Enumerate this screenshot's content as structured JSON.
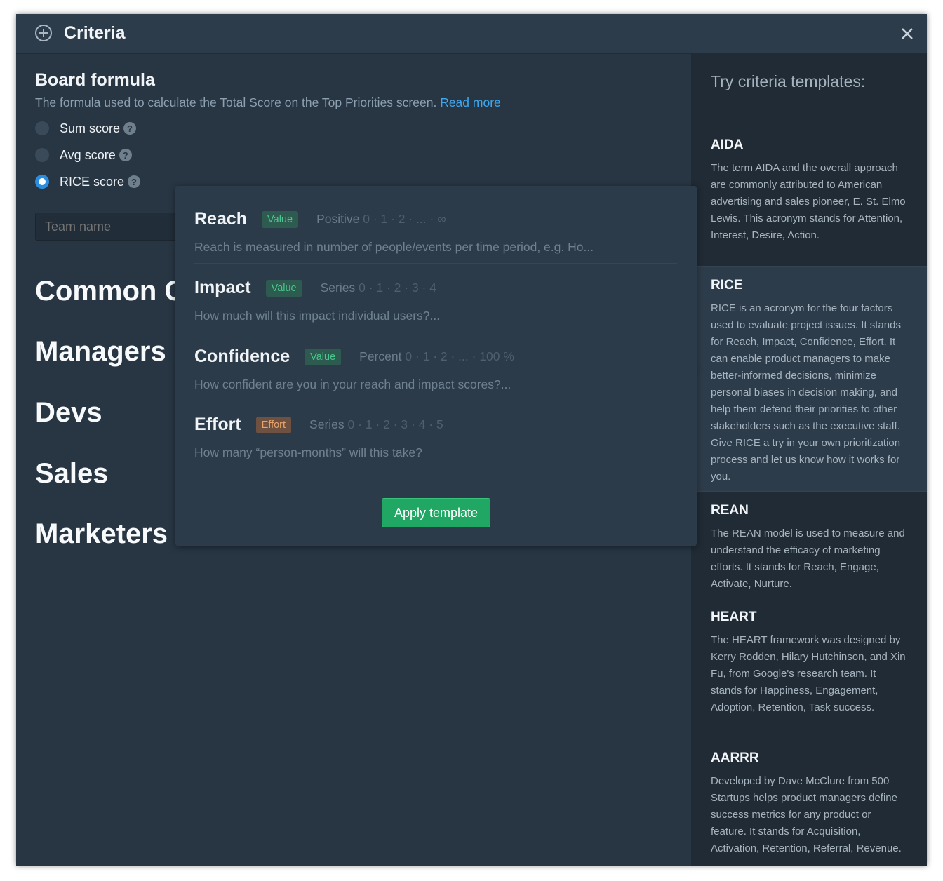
{
  "header": {
    "title": "Criteria"
  },
  "board_formula": {
    "title": "Board formula",
    "description": "The formula used to calculate the Total Score on the Top Priorities screen.",
    "read_more": "Read more",
    "options": [
      {
        "label": "Sum score",
        "checked": false
      },
      {
        "label": "Avg score",
        "checked": false
      },
      {
        "label": "RICE score",
        "checked": true
      }
    ],
    "help_glyph": "?"
  },
  "team_input": {
    "placeholder": "Team name"
  },
  "groups": [
    "Common C",
    "Managers",
    "Devs",
    "Sales",
    "Marketers"
  ],
  "templates": {
    "heading": "Try criteria templates:",
    "items": [
      {
        "name": "AIDA",
        "description": "The term AIDA and the overall approach are commonly attributed to American advertising and sales pioneer, E. St. Elmo Lewis. This acronym stands for Attention, Interest, Desire, Action."
      },
      {
        "name": "RICE",
        "description": "RICE is an acronym for the four factors used to evaluate project issues. It stands for Reach, Impact, Confidence, Effort. It can enable product managers to make better-informed decisions, minimize personal biases in decision making, and help them defend their priorities to other stakeholders such as the executive staff. Give RICE a try in your own prioritization process and let us know how it works for you."
      },
      {
        "name": "REAN",
        "description": "The REAN model is used to measure and understand the efficacy of marketing efforts. It stands for Reach, Engage, Activate, Nurture."
      },
      {
        "name": "HEART",
        "description": "The HEART framework was designed by Kerry Rodden, Hilary Hutchinson, and Xin Fu, from Google's research team. It stands for Happiness, Engagement, Adoption, Retention, Task success."
      },
      {
        "name": "AARRR",
        "description": "Developed by Dave McClure from 500 Startups helps product managers define success metrics for any product or feature. It stands for Acquisition, Activation, Retention, Referral, Revenue."
      }
    ]
  },
  "popover": {
    "criteria": [
      {
        "name": "Reach",
        "badge": "Value",
        "scale_type": "Positive",
        "scale": "0 · 1 · 2 · ... · ∞",
        "description": "Reach is measured in number of people/events per time period, e.g. Ho..."
      },
      {
        "name": "Impact",
        "badge": "Value",
        "scale_type": "Series",
        "scale": "0 · 1 · 2 · 3 · 4",
        "description": "How much will this impact individual users?..."
      },
      {
        "name": "Confidence",
        "badge": "Value",
        "scale_type": "Percent",
        "scale": "0 · 1 · 2 · ... · 100 %",
        "description": "How confident are you in your reach and impact scores?..."
      },
      {
        "name": "Effort",
        "badge": "Effort",
        "scale_type": "Series",
        "scale": "0 · 1 · 2 · 3 · 4 · 5",
        "description": "How many “person-months” will this take?"
      }
    ],
    "apply_label": "Apply template"
  },
  "colors": {
    "accent": "#3ea8f0",
    "apply_green": "#1fa763",
    "value_badge": "#4cc58e",
    "effort_badge": "#e8a46b"
  },
  "icons": {
    "header": "plus-circle-icon",
    "close": "close-icon",
    "help": "question-mark-icon"
  }
}
